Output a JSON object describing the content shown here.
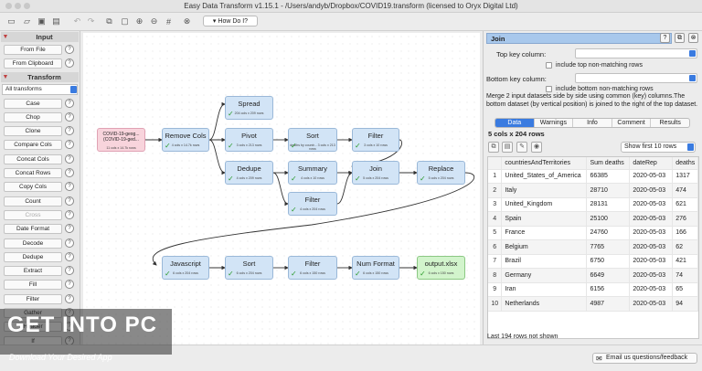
{
  "window": {
    "title": "Easy Data Transform v1.15.1 - /Users/andyb/Dropbox/COVID19.transform (licensed to Oryx Digital Ltd)"
  },
  "toolbar": {
    "howdoi": "How Do I?"
  },
  "sidebar": {
    "input_header": "Input",
    "input_items": [
      "From File",
      "From Clipboard"
    ],
    "transform_header": "Transform",
    "filter_value": "All transforms",
    "transform_items": [
      "Case",
      "Chop",
      "Clone",
      "Compare Cols",
      "Concat Cols",
      "Concat Rows",
      "Copy Cols",
      "Count",
      "Cross",
      "Date Format",
      "Decode",
      "Dedupe",
      "Extract",
      "Fill",
      "Filter",
      "Gather",
      "Header",
      "If"
    ],
    "help": "?"
  },
  "nodes": {
    "source": {
      "title": "COVID-19-geog... (COVID-19-ged...",
      "sub": "11 cols x 14.7k rows"
    },
    "removecols": {
      "title": "Remove Cols",
      "sub": "4 cols x 14.7k rows"
    },
    "spread": {
      "title": "Spread",
      "sub": "204 cols x 209 rows"
    },
    "pivot": {
      "title": "Pivot",
      "sub": "3 cols x 213 rows"
    },
    "dedupe": {
      "title": "Dedupe",
      "sub": "4 cols x 209 rows"
    },
    "sort1": {
      "title": "Sort",
      "sub": "deaths by countr... 3 cols x 213 rows"
    },
    "summary": {
      "title": "Summary",
      "sub": "4 cols x 10 rows"
    },
    "filter1": {
      "title": "Filter",
      "sub": "3 cols x 10 rows"
    },
    "filter2": {
      "title": "Filter",
      "sub": "4 cols x 204 rows"
    },
    "join": {
      "title": "Join",
      "sub": "5 cols x 204 rows"
    },
    "replace": {
      "title": "Replace",
      "sub": "5 cols x 204 rows"
    },
    "javascript": {
      "title": "Javascript",
      "sub": "6 cols x 204 rows"
    },
    "sort2": {
      "title": "Sort",
      "sub": "6 cols x 204 rows"
    },
    "filter3": {
      "title": "Filter",
      "sub": "6 cols x 150 rows"
    },
    "numformat": {
      "title": "Num Format",
      "sub": "6 cols x 150 rows"
    },
    "output": {
      "title": "output.xlsx",
      "sub": "6 cols x 150 rows"
    }
  },
  "panel": {
    "title": "Join",
    "top_key_label": "Top key column:",
    "top_nonmatch": "include top non-matching rows",
    "bottom_key_label": "Bottom key column:",
    "bottom_nonmatch": "include bottom non-matching rows",
    "description": "Merge 2 input datasets side by side using common (key) columns.The bottom dataset (by vertical position) is joined to the right of the top dataset.",
    "tabs": [
      "Data",
      "Warnings",
      "Info",
      "Comment",
      "Results"
    ],
    "dims": "5 cols x 204 rows",
    "show": "Show first 10 rows",
    "columns": [
      "",
      "countriesAndTerritories",
      "Sum deaths",
      "dateRep",
      "deaths"
    ],
    "rows": [
      [
        "1",
        "United_States_of_America",
        "66385",
        "2020-05-03",
        "1317"
      ],
      [
        "2",
        "Italy",
        "28710",
        "2020-05-03",
        "474"
      ],
      [
        "3",
        "United_Kingdom",
        "28131",
        "2020-05-03",
        "621"
      ],
      [
        "4",
        "Spain",
        "25100",
        "2020-05-03",
        "276"
      ],
      [
        "5",
        "France",
        "24760",
        "2020-05-03",
        "166"
      ],
      [
        "6",
        "Belgium",
        "7765",
        "2020-05-03",
        "62"
      ],
      [
        "7",
        "Brazil",
        "6750",
        "2020-05-03",
        "421"
      ],
      [
        "8",
        "Germany",
        "6649",
        "2020-05-03",
        "74"
      ],
      [
        "9",
        "Iran",
        "6156",
        "2020-05-03",
        "65"
      ],
      [
        "10",
        "Netherlands",
        "4987",
        "2020-05-03",
        "94"
      ]
    ],
    "footer": "Last 194 rows not shown"
  },
  "bottom": {
    "email": "Email us questions/feedback"
  },
  "watermark": {
    "big": "GET INTO PC",
    "small": "Download Your Desired App"
  }
}
